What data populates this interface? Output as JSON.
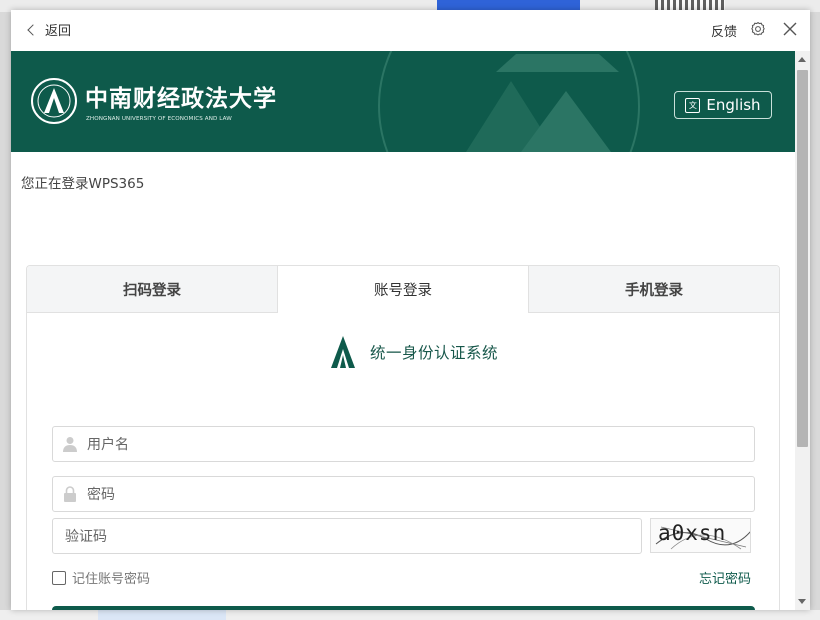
{
  "window": {
    "back_label": "返回",
    "feedback_label": "反馈"
  },
  "banner": {
    "school_name_cn": "中南财经政法大学",
    "school_name_en": "ZHONGNAN UNIVERSITY OF ECONOMICS AND LAW",
    "language_button": "English",
    "language_icon_glyph": "文"
  },
  "notice": "您正在登录WPS365",
  "login": {
    "tabs": [
      {
        "label": "扫码登录",
        "active": false
      },
      {
        "label": "账号登录",
        "active": true
      },
      {
        "label": "手机登录",
        "active": false
      }
    ],
    "system_title": "统一身份认证系统",
    "username_placeholder": "用户名",
    "password_placeholder": "密码",
    "captcha_placeholder": "验证码",
    "captcha_text": "a0xsn",
    "remember_label": "记住账号密码",
    "forgot_label": "忘记密码"
  },
  "colors": {
    "brand": "#0e5a4b",
    "link": "#0e5a4b"
  }
}
